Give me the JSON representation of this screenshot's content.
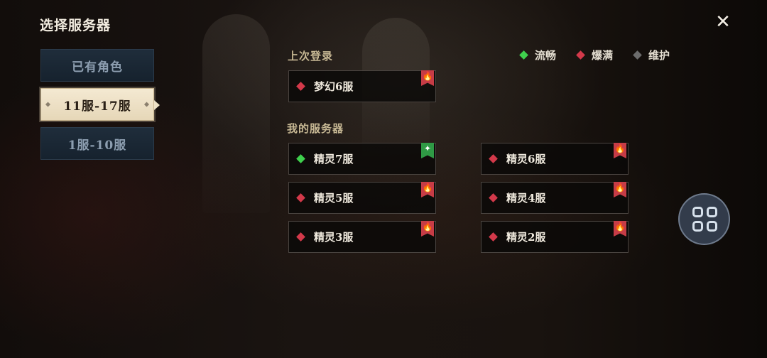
{
  "window": {
    "title": "选择服务器"
  },
  "tabs": [
    {
      "label": "已有角色",
      "active": false
    },
    {
      "label": "11服-17服",
      "active": true
    },
    {
      "label": "1服-10服",
      "active": false
    }
  ],
  "sections": {
    "last_login": "上次登录",
    "my_servers": "我的服务器"
  },
  "legend": [
    {
      "label": "流畅",
      "color": "#3fd04d"
    },
    {
      "label": "爆满",
      "color": "#d3394a"
    },
    {
      "label": "维护",
      "color": "#6c6c6c"
    }
  ],
  "last_login_server": {
    "name": "梦幻6服",
    "status": "爆满",
    "badge_icon": "fire-icon"
  },
  "my_servers": [
    {
      "name": "精灵7服",
      "status": "流畅",
      "badge_icon": "sparkle-icon"
    },
    {
      "name": "精灵6服",
      "status": "爆满",
      "badge_icon": "fire-icon"
    },
    {
      "name": "精灵5服",
      "status": "爆满",
      "badge_icon": "fire-icon"
    },
    {
      "name": "精灵4服",
      "status": "爆满",
      "badge_icon": "fire-icon"
    },
    {
      "name": "精灵3服",
      "status": "爆满",
      "badge_icon": "fire-icon"
    },
    {
      "name": "精灵2服",
      "status": "爆满",
      "badge_icon": "fire-icon"
    }
  ],
  "icons": {
    "close": "close-icon",
    "menu": "grid-menu-icon"
  }
}
